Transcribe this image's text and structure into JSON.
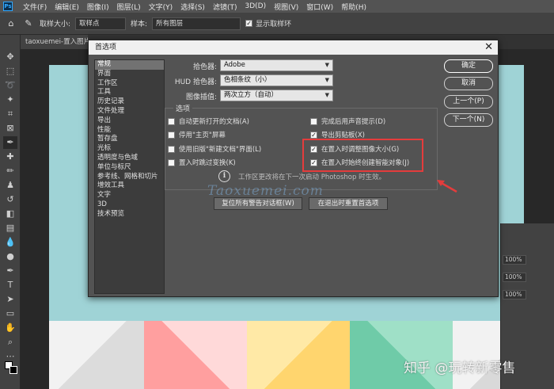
{
  "app": {
    "logo": "Ps"
  },
  "menubar": {
    "items": [
      "文件(F)",
      "编辑(E)",
      "图像(I)",
      "图层(L)",
      "文字(Y)",
      "选择(S)",
      "滤镜(T)",
      "3D(D)",
      "视图(V)",
      "窗口(W)",
      "帮助(H)"
    ]
  },
  "options_bar": {
    "sample_size_label": "取样大小:",
    "sample_size_value": "取样点",
    "sample_label": "样本:",
    "sample_value": "所有图层",
    "show_ring_label": "显示取样环",
    "show_ring_checked": true
  },
  "document_tab": {
    "label": "taoxuemei-置入图片"
  },
  "right_panel": {
    "opacity_1": "100%",
    "opacity_2": "100%",
    "opacity_3": "100%"
  },
  "dialog": {
    "title": "首选项",
    "close_icon": "close-icon",
    "nav_items": [
      "常规",
      "界面",
      "工作区",
      "工具",
      "历史记录",
      "文件处理",
      "导出",
      "性能",
      "暂存盘",
      "光标",
      "透明度与色域",
      "单位与标尺",
      "参考线、网格和切片",
      "增效工具",
      "文字",
      "3D",
      "技术预览"
    ],
    "nav_active_index": 0,
    "color_picker_label": "拾色器:",
    "color_picker_value": "Adobe",
    "hud_picker_label": "HUD 拾色器:",
    "hud_picker_value": "色相条纹（小）",
    "interpolation_label": "图像插值:",
    "interpolation_value": "两次立方（自动）",
    "options_group_title": "选项",
    "options_left": [
      {
        "label": "自动更新打开的文档(A)",
        "checked": false
      },
      {
        "label": "停用\"主页\"屏幕",
        "checked": false
      },
      {
        "label": "使用旧版\"新建文档\"界面(L)",
        "checked": false
      },
      {
        "label": "置入时跳过变换(K)",
        "checked": false
      }
    ],
    "options_right": [
      {
        "label": "完成后用声音提示(D)",
        "checked": false
      },
      {
        "label": "导出剪贴板(X)",
        "checked": true
      },
      {
        "label": "在置入时调整图像大小(G)",
        "checked": true
      },
      {
        "label": "在置入时始终创建智能对象(J)",
        "checked": true
      }
    ],
    "hint_text": "工作区更改将在下一次启动 Photoshop 时生效。",
    "reset_warnings_label": "复位所有警告对话框(W)",
    "reset_on_exit_label": "在退出时重置首选项",
    "ok_label": "确定",
    "cancel_label": "取消",
    "prev_label": "上一个(P)",
    "next_label": "下一个(N)"
  },
  "watermark": {
    "text": "Taoxuemei.com"
  },
  "footer_watermark": {
    "text": "知乎 @玩转新零售"
  },
  "colors": {
    "highlight_box": "#e43c3c"
  }
}
